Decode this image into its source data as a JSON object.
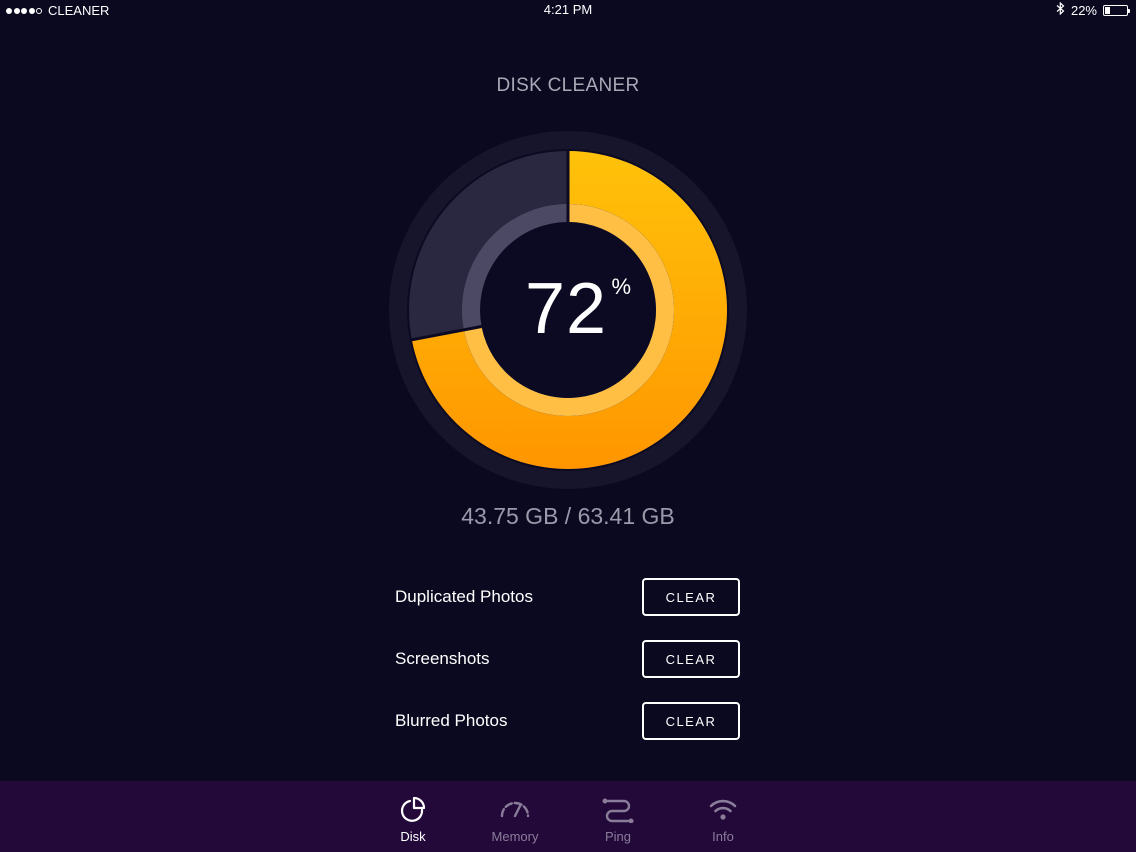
{
  "status_bar": {
    "carrier": "CLEANER",
    "time": "4:21 PM",
    "battery": "22%",
    "battery_level": 0.22,
    "signal_strength": 4
  },
  "title": "DISK CLEANER",
  "gauge": {
    "percent": "72",
    "percent_sign": "%",
    "value": 72,
    "fill_color": "#ffb000",
    "track_color": "#2a2740"
  },
  "usage_text": "43.75 GB / 63.41 GB",
  "items": [
    {
      "label": "Duplicated Photos",
      "button": "CLEAR"
    },
    {
      "label": "Screenshots",
      "button": "CLEAR"
    },
    {
      "label": "Blurred Photos",
      "button": "CLEAR"
    }
  ],
  "tabs": [
    {
      "label": "Disk",
      "icon": "pie-chart-icon",
      "active": true
    },
    {
      "label": "Memory",
      "icon": "speedometer-icon",
      "active": false
    },
    {
      "label": "Ping",
      "icon": "route-icon",
      "active": false
    },
    {
      "label": "Info",
      "icon": "wifi-icon",
      "active": false
    }
  ],
  "colors": {
    "background": "#0b0920",
    "tabbar": "#23093a",
    "accent": "#ffa500"
  }
}
